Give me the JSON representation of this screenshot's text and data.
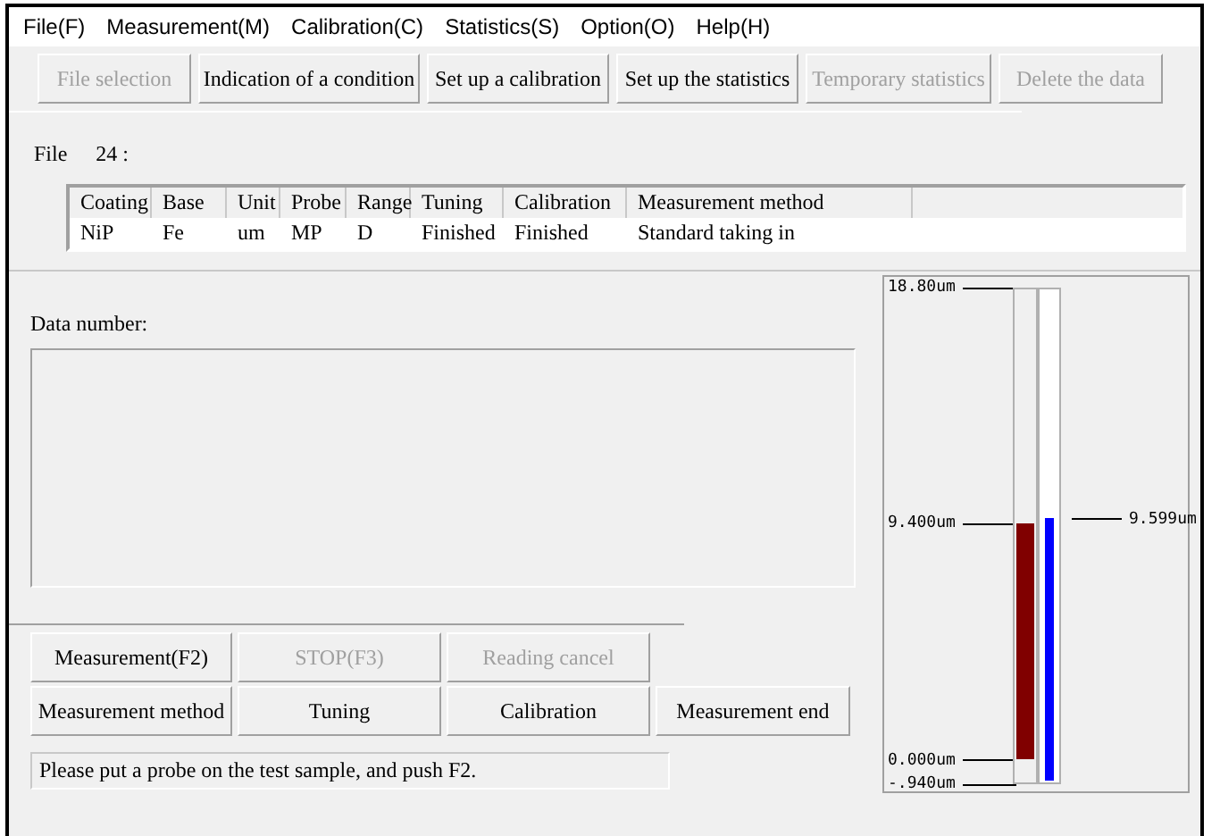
{
  "menu_bar": [
    "File(F)",
    "Measurement(M)",
    "Calibration(C)",
    "Statistics(S)",
    "Option(O)",
    "Help(H)"
  ],
  "toolbar": [
    {
      "label": "File selection",
      "disabled": true
    },
    {
      "label": "Indication of a condition",
      "disabled": false
    },
    {
      "label": "Set up a calibration",
      "disabled": false
    },
    {
      "label": "Set up the statistics",
      "disabled": false
    },
    {
      "label": "Temporary statistics",
      "disabled": true
    },
    {
      "label": "Delete the data",
      "disabled": true
    }
  ],
  "file": {
    "label": "File",
    "number": "24 :"
  },
  "table": {
    "columns": [
      "Coating",
      "Base",
      "Unit",
      "Probe",
      "Range",
      "Tuning",
      "Calibration",
      "Measurement method"
    ],
    "rows": [
      [
        "NiP",
        "Fe",
        "um",
        "MP",
        "D",
        "Finished",
        "Finished",
        "Standard taking in"
      ]
    ]
  },
  "data_number": {
    "label": "Data number:"
  },
  "buttons": [
    [
      {
        "label": "Measurement(F2)",
        "disabled": false
      },
      {
        "label": "STOP(F3)",
        "disabled": true
      },
      {
        "label": "Reading cancel",
        "disabled": true
      }
    ],
    [
      {
        "label": "Measurement method",
        "disabled": false
      },
      {
        "label": "Tuning",
        "disabled": false
      },
      {
        "label": "Calibration",
        "disabled": false
      },
      {
        "label": "Measurement end",
        "disabled": false
      }
    ]
  ],
  "status": "Please put a probe on the test sample, and push F2.",
  "gauge": {
    "ticks": [
      "18.80um",
      "9.400um",
      "0.000um",
      "-.940um"
    ],
    "reference": {
      "level": 0.476,
      "color": "#800000"
    },
    "measured": {
      "level": 0.534,
      "color": "#0000ff",
      "reading": "9.599um"
    }
  }
}
